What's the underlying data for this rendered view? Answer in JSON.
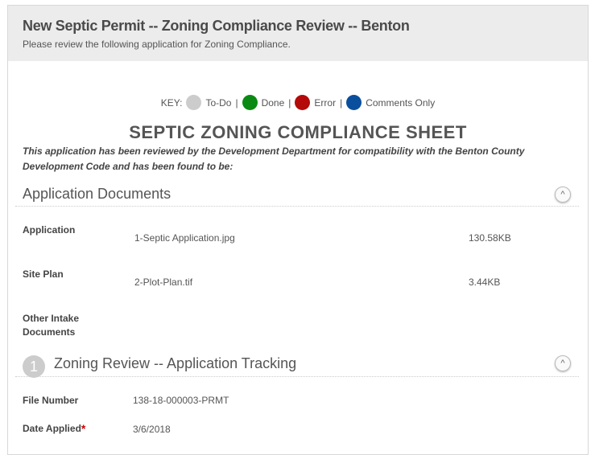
{
  "header": {
    "title": "New Septic Permit -- Zoning Compliance Review -- Benton",
    "subtitle": "Please review the following application for Zoning Compliance."
  },
  "key": {
    "label": "KEY:",
    "items": [
      {
        "label": "To-Do",
        "color": "#cccccc"
      },
      {
        "label": "Done",
        "color": "#0a8a12"
      },
      {
        "label": "Error",
        "color": "#b50a0a"
      },
      {
        "label": "Comments Only",
        "color": "#0a4f9e"
      }
    ],
    "separator": "|"
  },
  "sheet": {
    "title": "SEPTIC ZONING COMPLIANCE SHEET",
    "description": "This application has been reviewed by the Development Department for compatibility with the Benton County Development Code and has been found to be:"
  },
  "documents": {
    "title": "Application Documents",
    "rows": [
      {
        "label": "Application",
        "file": "1-Septic Application.jpg",
        "size": "130.58KB"
      },
      {
        "label": "Site Plan",
        "file": "2-Plot-Plan.tif",
        "size": "3.44KB"
      },
      {
        "label": "Other Intake Documents"
      }
    ]
  },
  "tracking": {
    "number": "1",
    "title": "Zoning Review -- Application Tracking",
    "fields": [
      {
        "label": "File Number",
        "value": "138-18-000003-PRMT"
      },
      {
        "label": "Date Applied",
        "value": "3/6/2018",
        "required": "*"
      }
    ]
  },
  "icons": {
    "collapse": "^"
  }
}
